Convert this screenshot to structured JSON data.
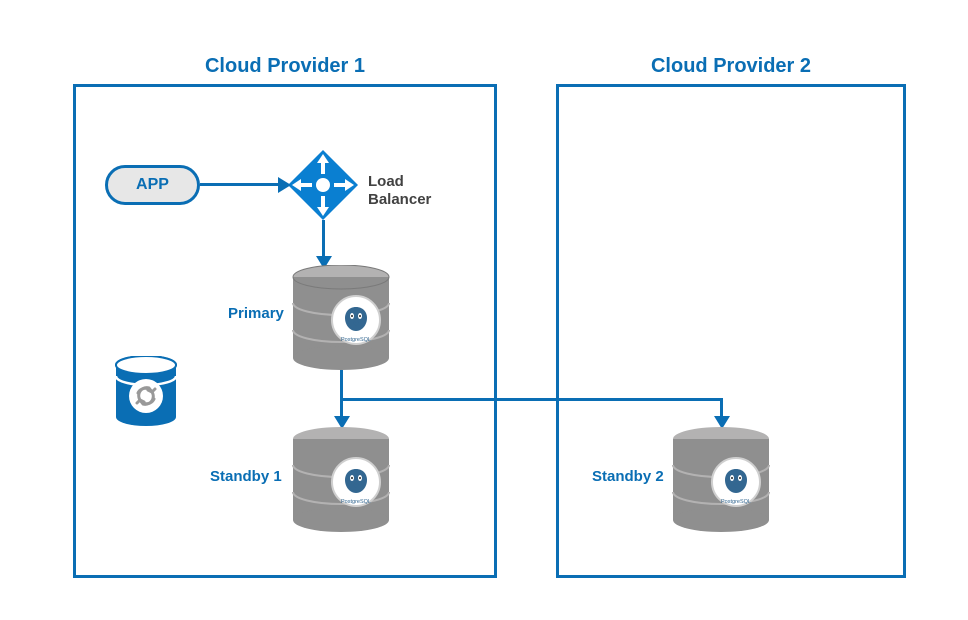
{
  "providers": {
    "p1": {
      "title": "Cloud Provider 1"
    },
    "p2": {
      "title": "Cloud Provider 2"
    }
  },
  "nodes": {
    "app": {
      "label": "APP"
    },
    "loadBalancer": {
      "label": "Load\nBalancer"
    },
    "primary": {
      "label": "Primary",
      "engine": "PostgreSQL"
    },
    "standby1": {
      "label": "Standby 1",
      "engine": "PostgreSQL"
    },
    "standby2": {
      "label": "Standby 2",
      "engine": "PostgreSQL"
    },
    "clusterControl": {
      "label": ""
    }
  },
  "colors": {
    "accent": "#0a6eb4",
    "cylinderTop": "#b3b2b2",
    "cylinderBody": "#8f8f8f"
  }
}
